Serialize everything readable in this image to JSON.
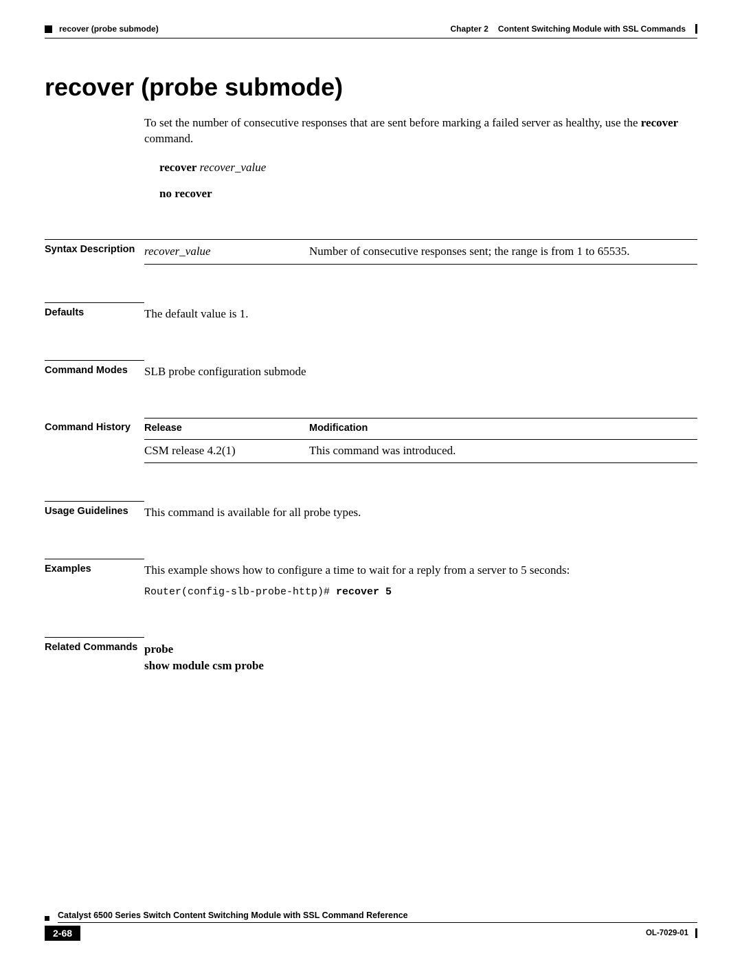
{
  "header": {
    "breadcrumb": "recover (probe submode)",
    "chapter_label": "Chapter 2",
    "chapter_title": "Content Switching Module with SSL Commands"
  },
  "title": "recover (probe submode)",
  "intro": {
    "pre": "To set the number of consecutive responses that are sent before marking a failed server as healthy, use the ",
    "cmd": "recover",
    "post": " command."
  },
  "syntax": {
    "cmd1_bold": "recover",
    "cmd1_italic": "recover_value",
    "cmd2_bold": "no recover"
  },
  "sections": {
    "syntax_description": {
      "label": "Syntax Description",
      "param": "recover_value",
      "desc": "Number of consecutive responses sent; the range is from 1 to 65535."
    },
    "defaults": {
      "label": "Defaults",
      "text": "The default value is 1."
    },
    "command_modes": {
      "label": "Command Modes",
      "text": "SLB probe configuration submode"
    },
    "command_history": {
      "label": "Command History",
      "col1": "Release",
      "col2": "Modification",
      "row_release": "CSM release 4.2(1)",
      "row_mod": "This command was introduced."
    },
    "usage_guidelines": {
      "label": "Usage Guidelines",
      "text": "This command is available for all probe types."
    },
    "examples": {
      "label": "Examples",
      "text": "This example shows how to configure a time to wait for a reply from a server to 5 seconds:",
      "prompt": "Router(config-slb-probe-http)# ",
      "cmd": "recover 5"
    },
    "related_commands": {
      "label": "Related Commands",
      "line1": "probe",
      "line2": "show module csm probe"
    }
  },
  "footer": {
    "title": "Catalyst 6500 Series Switch Content Switching Module with SSL Command Reference",
    "page_num": "2-68",
    "doc_id": "OL-7029-01"
  }
}
